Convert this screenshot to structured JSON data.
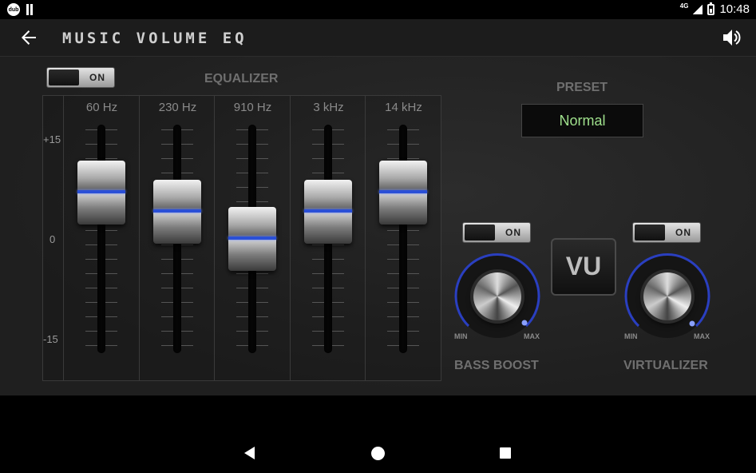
{
  "status": {
    "badge": "dub",
    "network": "4G",
    "time": "10:48"
  },
  "app_bar": {
    "title": "MUSIC VOLUME EQ"
  },
  "equalizer": {
    "toggle_label": "ON",
    "title": "EQUALIZER",
    "scale": {
      "top": "+15",
      "mid": "0",
      "bottom": "-15"
    },
    "bands": [
      {
        "label": "60 Hz",
        "level": 0.48
      },
      {
        "label": "230 Hz",
        "level": 0.28
      },
      {
        "label": "910 Hz",
        "level": 0.0
      },
      {
        "label": "3 kHz",
        "level": 0.28
      },
      {
        "label": "14 kHz",
        "level": 0.48
      }
    ]
  },
  "preset": {
    "title": "PRESET",
    "value": "Normal"
  },
  "bass_boost": {
    "toggle_label": "ON",
    "label": "BASS BOOST",
    "min": "MIN",
    "max": "MAX"
  },
  "virtualizer": {
    "toggle_label": "ON",
    "label": "VIRTUALIZER",
    "min": "MIN",
    "max": "MAX"
  },
  "vu_button": {
    "label": "VU"
  },
  "colors": {
    "accent_blue": "#2a4fd6",
    "preset_text": "#9fe08c"
  }
}
